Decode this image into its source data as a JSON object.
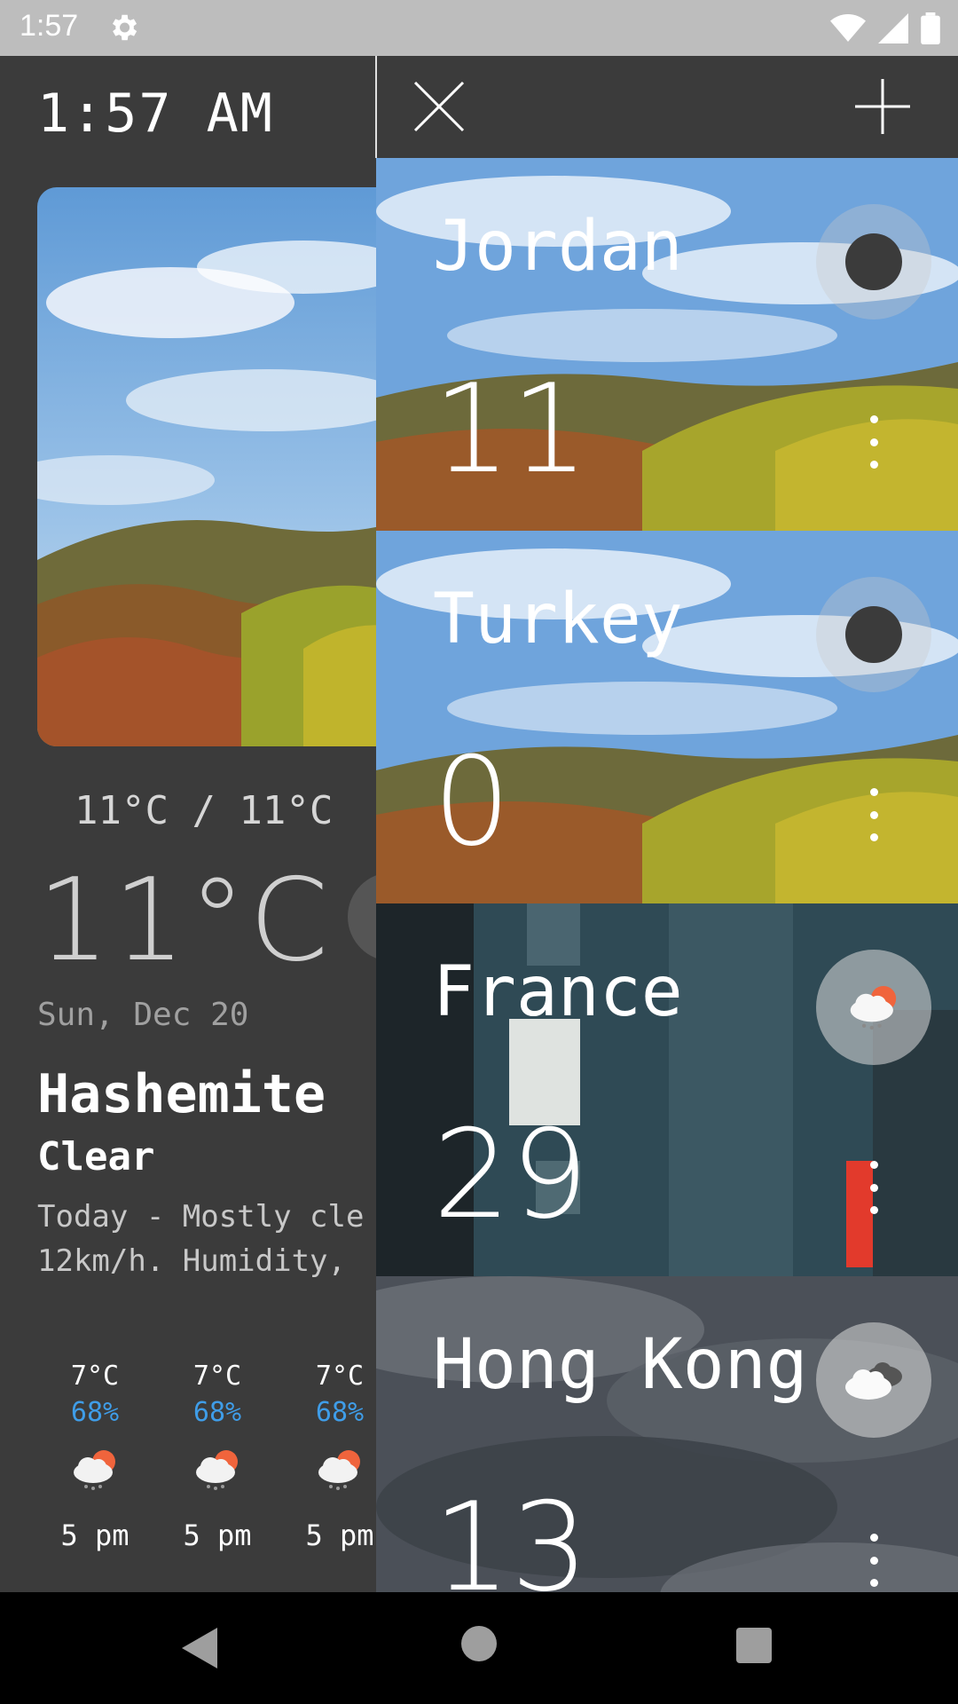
{
  "status_bar": {
    "time": "1:57"
  },
  "left": {
    "clock": "1:57 AM",
    "range": "11°C / 11°C",
    "big_temp": "11°C",
    "date": "Sun, Dec 20",
    "city": "Hashemite",
    "condition": "Clear",
    "desc_line1": "Today - Mostly cle",
    "desc_line2": "12km/h. Humidity,",
    "hourly": [
      {
        "temp": "7°C",
        "humidity": "68%",
        "time": "5 pm",
        "icon": "partly-rainy-icon"
      },
      {
        "temp": "7°C",
        "humidity": "68%",
        "time": "5 pm",
        "icon": "partly-rainy-icon"
      },
      {
        "temp": "7°C",
        "humidity": "68%",
        "time": "5 pm",
        "icon": "partly-rainy-icon"
      }
    ]
  },
  "cards": [
    {
      "country": "Jordan",
      "temp": "11",
      "icon": "dark-dot-icon",
      "bg": "landscape"
    },
    {
      "country": "Turkey",
      "temp": "0",
      "icon": "dark-dot-icon",
      "bg": "landscape"
    },
    {
      "country": "France",
      "temp": "29",
      "icon": "rain-sun-cloud-icon",
      "bg": "city"
    },
    {
      "country": "Hong Kong",
      "temp": "13",
      "icon": "cloudy-icon",
      "bg": "storm"
    }
  ],
  "colors": {
    "panel": "#3b3b3b",
    "humidity": "#3f9de8",
    "status_bar": "#bdbdbd"
  }
}
